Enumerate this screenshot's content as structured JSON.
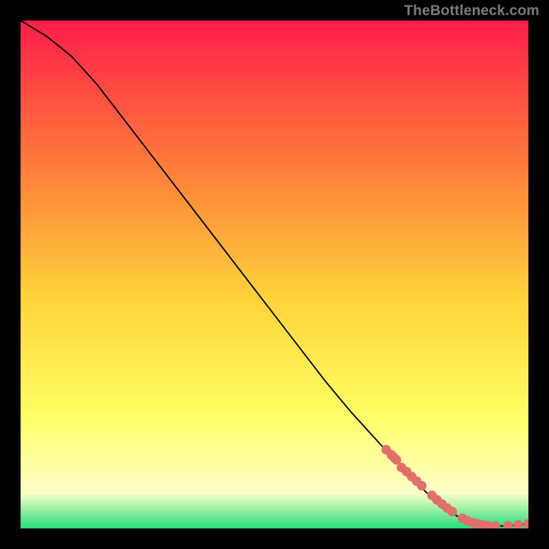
{
  "watermark": "TheBottleneck.com",
  "colors": {
    "background": "#000000",
    "gradient_top": "#ff1d4a",
    "gradient_mid1": "#ff7a3a",
    "gradient_mid2": "#ffd43a",
    "gradient_mid3": "#ffff66",
    "gradient_mid4": "#fdffc8",
    "gradient_bottom": "#24de7b",
    "line": "#000000",
    "marker": "#e2706a"
  },
  "chart_data": {
    "type": "line",
    "title": "",
    "xlabel": "",
    "ylabel": "",
    "xlim": [
      0,
      100
    ],
    "ylim": [
      0,
      100
    ],
    "series": [
      {
        "name": "curve",
        "x": [
          0,
          5,
          10,
          15,
          20,
          25,
          30,
          35,
          40,
          45,
          50,
          55,
          60,
          65,
          70,
          75,
          80,
          83,
          86,
          88,
          90,
          92,
          94,
          96,
          98,
          100
        ],
        "y": [
          100,
          97,
          93,
          87.5,
          81,
          74.5,
          68,
          61.5,
          55,
          48.5,
          42,
          35.5,
          29,
          23,
          17.5,
          12,
          7,
          4.3,
          2.4,
          1.4,
          0.9,
          0.55,
          0.45,
          0.5,
          0.7,
          0.9
        ]
      }
    ],
    "markers": {
      "name": "highlighted-points",
      "x": [
        72,
        73,
        73.5,
        74,
        75,
        76,
        77,
        78,
        79,
        81,
        82,
        83,
        84,
        85,
        87,
        88,
        89,
        90,
        91,
        92,
        93.5,
        96,
        98,
        100
      ],
      "y": [
        15.5,
        14.5,
        14.0,
        13.5,
        12.0,
        11.2,
        10.2,
        9.3,
        8.4,
        6.5,
        5.6,
        4.8,
        4.0,
        3.3,
        2.0,
        1.5,
        1.1,
        0.9,
        0.7,
        0.55,
        0.45,
        0.5,
        0.7,
        0.9
      ]
    }
  }
}
